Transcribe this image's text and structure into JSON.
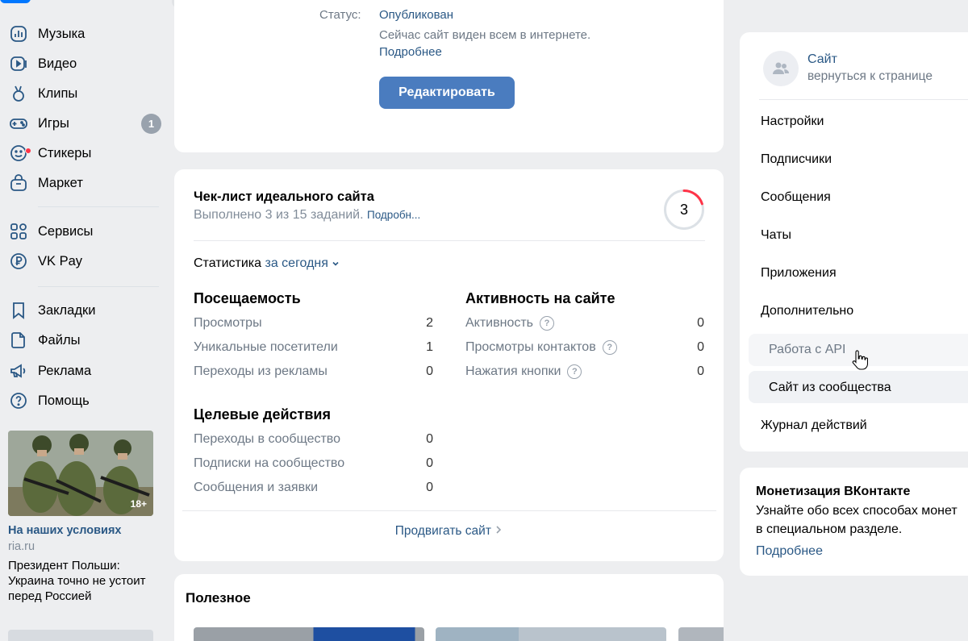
{
  "nav": {
    "items": [
      {
        "label": "Музыка",
        "icon": "music-icon"
      },
      {
        "label": "Видео",
        "icon": "video-icon"
      },
      {
        "label": "Клипы",
        "icon": "clips-icon"
      },
      {
        "label": "Игры",
        "icon": "games-icon",
        "badge": "1"
      },
      {
        "label": "Стикеры",
        "icon": "stickers-icon"
      },
      {
        "label": "Маркет",
        "icon": "market-icon"
      },
      {
        "label": "Сервисы",
        "icon": "services-icon"
      },
      {
        "label": "VK Pay",
        "icon": "vkpay-icon"
      },
      {
        "label": "Закладки",
        "icon": "bookmarks-icon"
      },
      {
        "label": "Файлы",
        "icon": "files-icon"
      },
      {
        "label": "Реклама",
        "icon": "ads-icon"
      },
      {
        "label": "Помощь",
        "icon": "help-icon"
      }
    ]
  },
  "ad": {
    "age": "18+",
    "title": "На наших условиях",
    "source": "ria.ru",
    "text": "Президент Польши: Украина точно не устоит перед Россией"
  },
  "publish": {
    "status_label": "Статус:",
    "status_value": "Опубликован",
    "description": "Сейчас сайт виден всем в интернете.",
    "more": "Подробнее",
    "edit_button": "Редактировать"
  },
  "checklist": {
    "title": "Чек-лист идеального сайта",
    "progress_text": "Выполнено 3 из 15 заданий.",
    "more": "Подробн...",
    "done": "3",
    "progress_fraction": 0.2
  },
  "stats": {
    "label": "Статистика",
    "period": "за сегодня",
    "attendance": {
      "title": "Посещаемость",
      "rows": [
        {
          "label": "Просмотры",
          "value": "2"
        },
        {
          "label": "Уникальные посетители",
          "value": "1"
        },
        {
          "label": "Переходы из рекламы",
          "value": "0"
        }
      ]
    },
    "activity": {
      "title": "Активность на сайте",
      "rows": [
        {
          "label": "Активность",
          "value": "0"
        },
        {
          "label": "Просмотры контактов",
          "value": "0"
        },
        {
          "label": "Нажатия кнопки",
          "value": "0"
        }
      ]
    },
    "goals": {
      "title": "Целевые действия",
      "rows": [
        {
          "label": "Переходы в сообщество",
          "value": "0"
        },
        {
          "label": "Подписки на сообщество",
          "value": "0"
        },
        {
          "label": "Сообщения и заявки",
          "value": "0"
        }
      ]
    },
    "promote": "Продвигать сайт"
  },
  "useful": {
    "title": "Полезное"
  },
  "side": {
    "site_title": "Сайт",
    "site_sub": "вернуться к странице",
    "menu": [
      "Настройки",
      "Подписчики",
      "Сообщения",
      "Чаты",
      "Приложения",
      "Дополнительно",
      "Работа с API",
      "Сайт из сообщества",
      "Журнал действий"
    ]
  },
  "monetization": {
    "title": "Монетизация ВКонтакте",
    "line1": "Узнайте обо всех способах монет",
    "line2": "в специальном разделе.",
    "more": "Подробнее"
  },
  "colors": {
    "accent": "#2a5885",
    "button": "#4a7cbf",
    "ring_progress": "#ff3347"
  }
}
